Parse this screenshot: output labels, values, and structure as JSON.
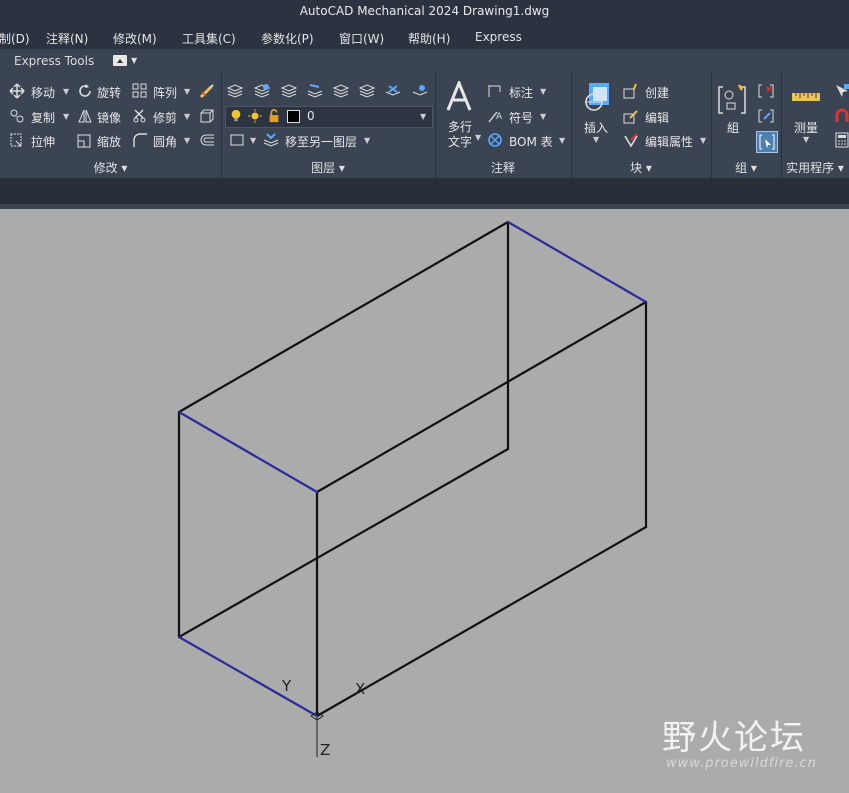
{
  "window": {
    "title": "AutoCAD Mechanical 2024    Drawing1.dwg"
  },
  "menu": [
    "制(D)",
    "注释(N)",
    "修改(M)",
    "工具集(C)",
    "参数化(P)",
    "窗口(W)",
    "帮助(H)",
    "Express"
  ],
  "tab": {
    "label": "Express Tools"
  },
  "modify": {
    "title": "修改",
    "move": "移动",
    "rotate": "旋转",
    "array": "阵列",
    "copy": "复制",
    "mirror": "镜像",
    "trim": "修剪",
    "stretch": "拉伸",
    "scale": "缩放",
    "fillet": "圆角"
  },
  "layers": {
    "title": "图层",
    "current": "0",
    "move_to_layer": "移至另一图层"
  },
  "annotation": {
    "title": "注释",
    "text_line1": "多行",
    "text_line2": "文字",
    "dimension": "标注",
    "symbol": "符号",
    "bom": "BOM 表"
  },
  "block": {
    "title": "块",
    "insert": "插入",
    "create": "创建",
    "edit": "编辑",
    "edit_attributes": "编辑属性"
  },
  "group": {
    "title": "组",
    "group": "組"
  },
  "utilities": {
    "title": "实用程序",
    "measure": "测量"
  },
  "ucs": {
    "y": "Y",
    "x": "X",
    "z": "Z"
  },
  "watermark": {
    "main": "野火论坛",
    "url": "www.proewildfire.cn"
  }
}
